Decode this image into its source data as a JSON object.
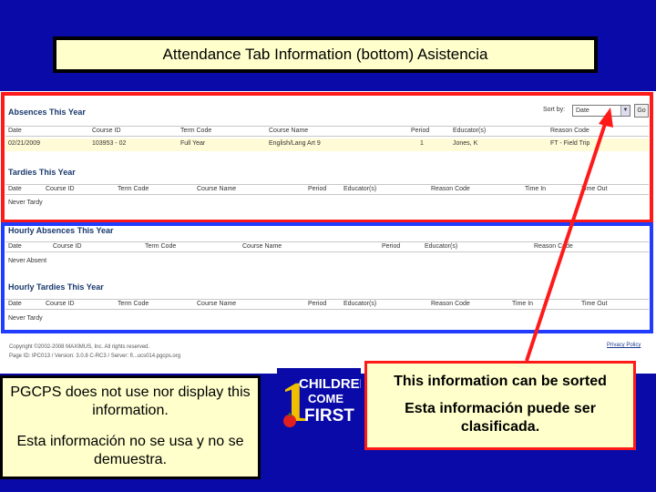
{
  "slide_title": "Attendance Tab Information (bottom) Asistencia",
  "absences": {
    "title": "Absences This Year",
    "sort_label": "Sort by:",
    "sort_value": "Date",
    "go_label": "Go",
    "headers": [
      "Date",
      "Course ID",
      "Term Code",
      "Course Name",
      "Period",
      "Educator(s)",
      "Reason Code"
    ],
    "row": [
      "02/21/2009",
      "103953 - 02",
      "Full Year",
      "English/Lang Art 9",
      "1",
      "Jones, K",
      "FT - Field Trip"
    ]
  },
  "tardies": {
    "title": "Tardies This Year",
    "headers": [
      "Date",
      "Course ID",
      "Term Code",
      "Course Name",
      "Period",
      "Educator(s)",
      "Reason Code",
      "Time In",
      "Time Out"
    ],
    "empty": "Never Tardy"
  },
  "hourly_absences": {
    "title": "Hourly Absences This Year",
    "headers": [
      "Date",
      "Course ID",
      "Term Code",
      "Course Name",
      "Period",
      "Educator(s)",
      "Reason Code"
    ],
    "empty": "Never Absent"
  },
  "hourly_tardies": {
    "title": "Hourly Tardies This Year",
    "headers": [
      "Date",
      "Course ID",
      "Term Code",
      "Course Name",
      "Period",
      "Educator(s)",
      "Reason Code",
      "Time In",
      "Time Out"
    ],
    "empty": "Never Tardy"
  },
  "footer": {
    "copyright": "Copyright ©2002-2008 MAXIMUS, Inc. All rights reserved.",
    "version": "Page ID: IPC013 / Version: 3.0.8 C-RC3 / Server: fl...ucs014.pgcps.org",
    "privacy_link": "Privacy Policy"
  },
  "note_left": {
    "line1": "PGCPS does not use nor display this information.",
    "line2": "Esta información no se usa y no se demuestra."
  },
  "note_right": {
    "line1": "This information can be sorted",
    "line2": "Esta información puede ser clasificada."
  },
  "logo": {
    "numeral": "1",
    "line1": "CHILDREN",
    "line2": "COME",
    "line3": "FIRST"
  },
  "colors": {
    "background": "#0a0aa8",
    "note_fill": "#ffffcc",
    "highlight_red": "#ff1a1a",
    "frame_blue": "#1f3cff"
  }
}
